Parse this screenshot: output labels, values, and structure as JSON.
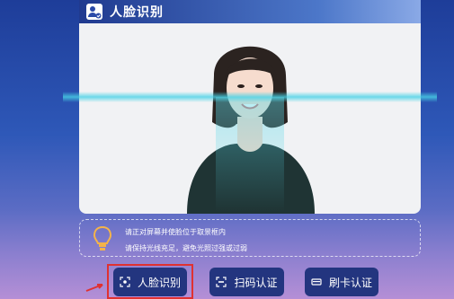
{
  "header": {
    "title": "人脸识别",
    "icon": "face-id-icon"
  },
  "tips": {
    "icon": "lightbulb-icon",
    "line1": "请正对屏幕并使脸位于取景框内",
    "line2": "请保持光线充足，避免光照过强或过弱"
  },
  "buttons": {
    "face": {
      "label": "人脸识别",
      "icon": "face-scan-icon"
    },
    "qr": {
      "label": "扫码认证",
      "icon": "qr-scan-icon"
    },
    "card": {
      "label": "刷卡认证",
      "icon": "card-icon"
    }
  },
  "colors": {
    "accent": "#23357f",
    "highlight": "#e03131",
    "scan": "#48d2e6"
  }
}
